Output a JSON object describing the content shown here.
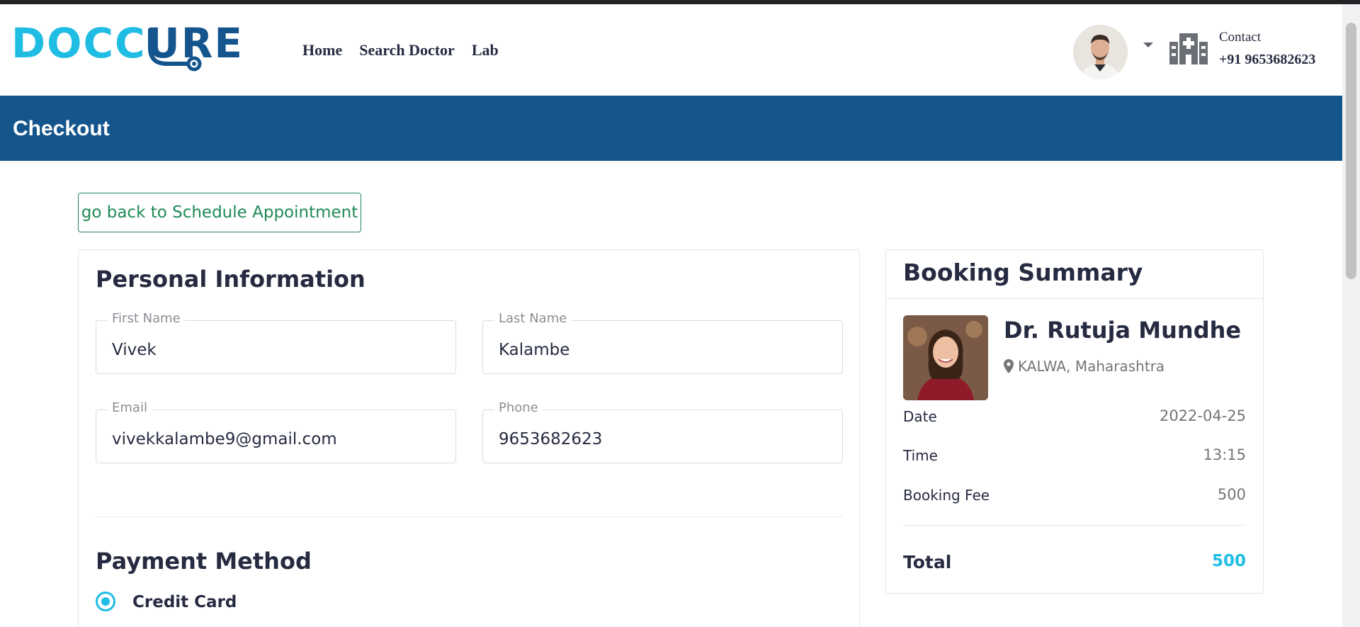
{
  "header": {
    "logo": {
      "part1": "DOCC",
      "part2": "URE"
    },
    "nav": [
      {
        "label": "Home"
      },
      {
        "label": "Search Doctor"
      },
      {
        "label": "Lab"
      }
    ],
    "contact_label": "Contact",
    "contact_phone": "+91 9653682623"
  },
  "breadcrumb": {
    "title": "Checkout"
  },
  "back_button": {
    "label": "go back to Schedule Appointment"
  },
  "personal_info": {
    "title": "Personal Information",
    "first_name": {
      "label": "First Name",
      "value": "Vivek"
    },
    "last_name": {
      "label": "Last Name",
      "value": "Kalambe"
    },
    "email": {
      "label": "Email",
      "value": "vivekkalambe9@gmail.com"
    },
    "phone": {
      "label": "Phone",
      "value": "9653682623"
    }
  },
  "payment": {
    "title": "Payment Method",
    "options": [
      {
        "label": "Credit Card",
        "selected": true
      }
    ]
  },
  "summary": {
    "title": "Booking Summary",
    "doctor_name": "Dr. Rutuja Mundhe",
    "location": "KALWA, Maharashtra",
    "rows": [
      {
        "label": "Date",
        "value": "2022-04-25"
      },
      {
        "label": "Time",
        "value": "13:15"
      },
      {
        "label": "Booking Fee",
        "value": "500"
      }
    ],
    "total_label": "Total",
    "total_value": "500"
  },
  "colors": {
    "brand_blue": "#15558d",
    "accent_cyan": "#1fbde3",
    "back_button_green": "#1f8a55"
  },
  "icons": [
    "stethoscope-icon",
    "chevron-down-icon",
    "hospital-icon",
    "map-marker-icon",
    "radio-checked-icon"
  ]
}
